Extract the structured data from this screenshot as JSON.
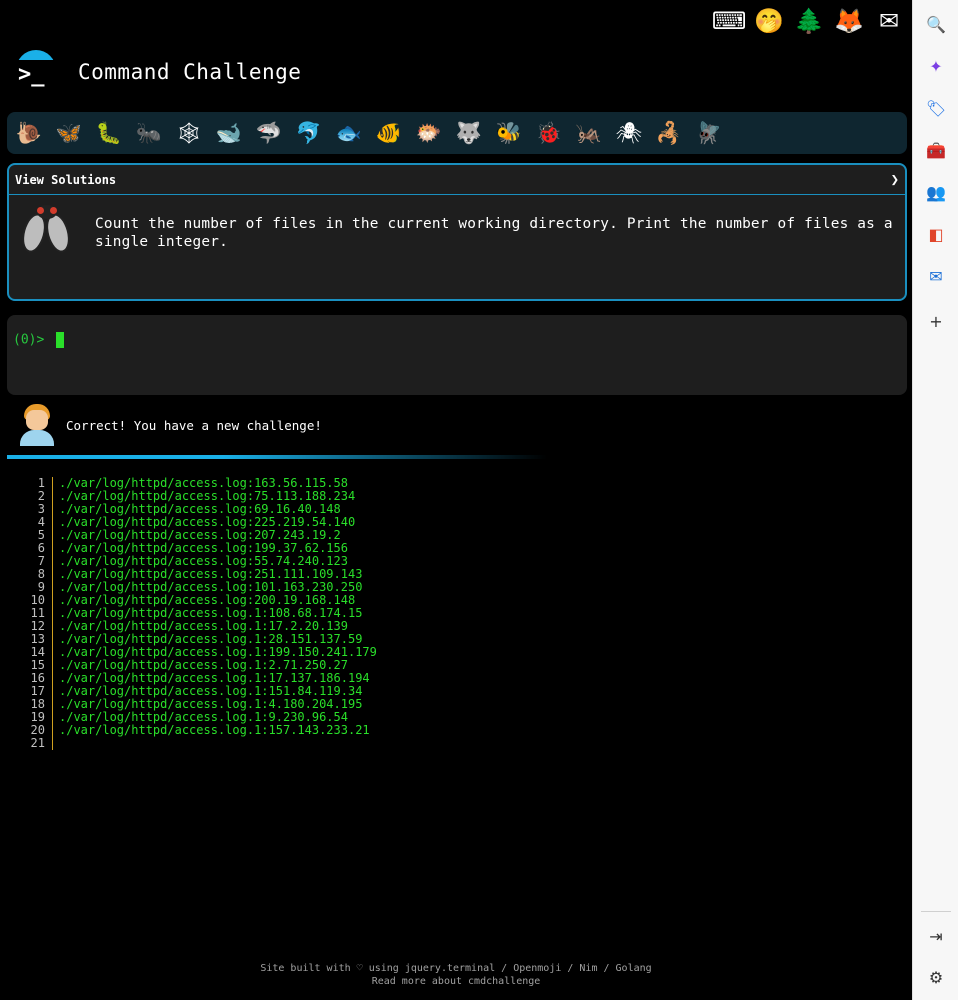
{
  "header": {
    "title": "Command Challenge"
  },
  "top_icons": [
    {
      "name": "cmd-logo-icon",
      "glyph": "⌨"
    },
    {
      "name": "hush-emoji-icon",
      "glyph": "🤭"
    },
    {
      "name": "tree-icon",
      "glyph": "🌲"
    },
    {
      "name": "gitlab-icon",
      "glyph": "🦊"
    },
    {
      "name": "mail-icon",
      "glyph": "✉"
    }
  ],
  "critters": [
    "🐌",
    "🦋",
    "🐛",
    "🐜",
    "🕸",
    "🐋",
    "🦈",
    "🐬",
    "🐟",
    "🐠",
    "🐡",
    "🐺",
    "🐝",
    "🐞",
    "🦗",
    "🕷",
    "🦂",
    "🪰"
  ],
  "challenge": {
    "toggle_label": "View Solutions",
    "chevron": "❯",
    "text": "Count the number of files in the current working directory. Print the number of files as a single integer."
  },
  "terminal": {
    "prompt": "(0)>"
  },
  "result": {
    "message": "Correct! You have a new challenge!"
  },
  "output_lines": [
    "./var/log/httpd/access.log:163.56.115.58",
    "./var/log/httpd/access.log:75.113.188.234",
    "./var/log/httpd/access.log:69.16.40.148",
    "./var/log/httpd/access.log:225.219.54.140",
    "./var/log/httpd/access.log:207.243.19.2",
    "./var/log/httpd/access.log:199.37.62.156",
    "./var/log/httpd/access.log:55.74.240.123",
    "./var/log/httpd/access.log:251.111.109.143",
    "./var/log/httpd/access.log:101.163.230.250",
    "./var/log/httpd/access.log:200.19.168.148",
    "./var/log/httpd/access.log.1:108.68.174.15",
    "./var/log/httpd/access.log.1:17.2.20.139",
    "./var/log/httpd/access.log.1:28.151.137.59",
    "./var/log/httpd/access.log.1:199.150.241.179",
    "./var/log/httpd/access.log.1:2.71.250.27",
    "./var/log/httpd/access.log.1:17.137.186.194",
    "./var/log/httpd/access.log.1:151.84.119.34",
    "./var/log/httpd/access.log.1:4.180.204.195",
    "./var/log/httpd/access.log.1:9.230.96.54",
    "./var/log/httpd/access.log.1:157.143.233.21",
    ""
  ],
  "footer": {
    "line1": "Site built with ♡ using jquery.terminal / Openmoji / Nim / Golang",
    "line2": "Read more about cmdchallenge"
  },
  "sidebar": [
    {
      "name": "search-icon",
      "glyph": "🔍",
      "color": "#1a5fd6"
    },
    {
      "name": "copilot-icon",
      "glyph": "✦",
      "color": "#7b3fe4"
    },
    {
      "name": "shopping-tag-icon",
      "glyph": "🏷",
      "color": "#1a6fe4"
    },
    {
      "name": "toolbox-icon",
      "glyph": "🧰",
      "color": "#2a9a6a"
    },
    {
      "name": "people-icon",
      "glyph": "👥",
      "color": "#1a6fe4"
    },
    {
      "name": "office-icon",
      "glyph": "◧",
      "color": "#e0452a"
    },
    {
      "name": "outlook-icon",
      "glyph": "✉",
      "color": "#1a6fd6"
    },
    {
      "name": "add-icon",
      "glyph": "+",
      "color": "#333333"
    },
    {
      "name": "panel-toggle-icon",
      "glyph": "⇥",
      "color": "#333333"
    },
    {
      "name": "settings-icon",
      "glyph": "⚙",
      "color": "#333333"
    }
  ]
}
